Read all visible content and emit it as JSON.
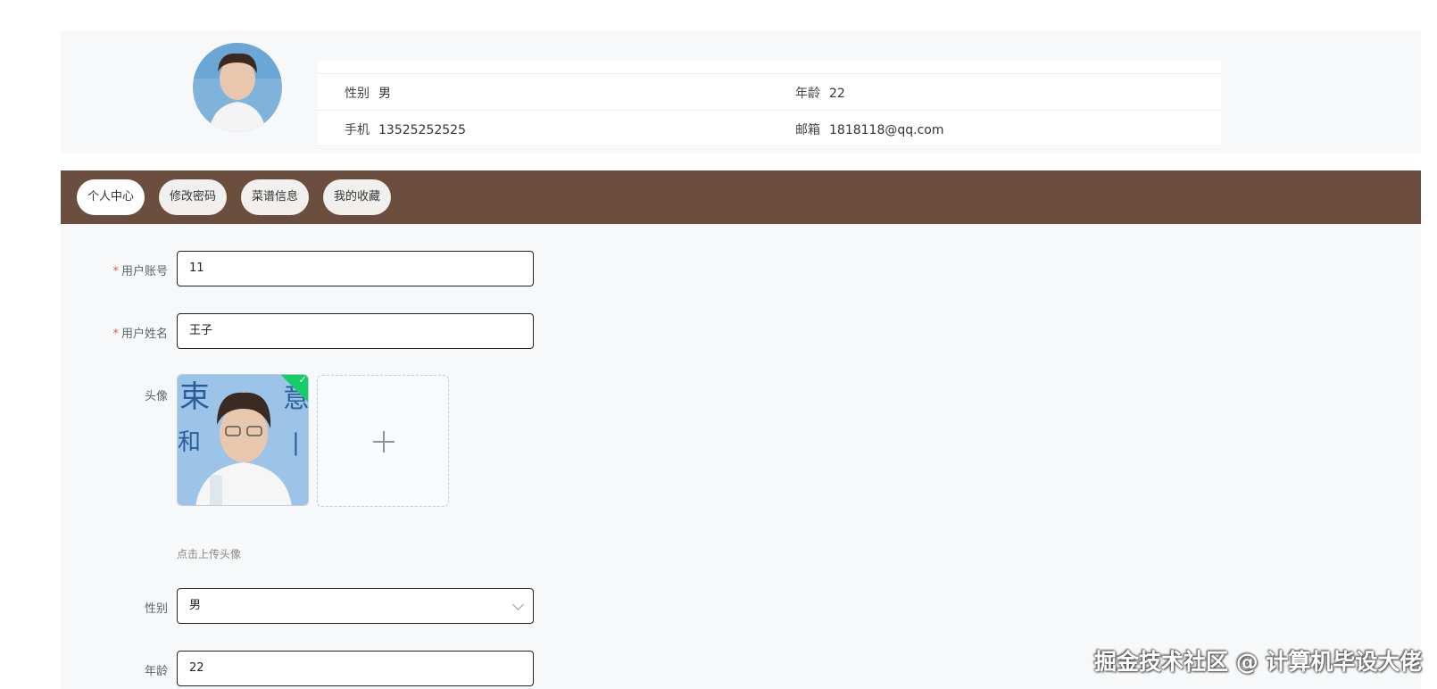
{
  "profile": {
    "gender_label": "性别",
    "gender_value": "男",
    "age_label": "年龄",
    "age_value": "22",
    "phone_label": "手机",
    "phone_value": "13525252525",
    "email_label": "邮箱",
    "email_value": "1818118@qq.com"
  },
  "tabs": [
    {
      "label": "个人中心",
      "active": true
    },
    {
      "label": "修改密码",
      "active": false
    },
    {
      "label": "菜谱信息",
      "active": false
    },
    {
      "label": "我的收藏",
      "active": false
    }
  ],
  "form": {
    "account_label": "用户账号",
    "account_value": "11",
    "name_label": "用户姓名",
    "name_value": "王子",
    "avatar_label": "头像",
    "upload_tip": "点击上传头像",
    "gender_label": "性别",
    "gender_value": "男",
    "age_label": "年龄",
    "age_value": "22",
    "required_mark": "*"
  },
  "watermark": "掘金技术社区 @ 计算机毕设大佬",
  "colors": {
    "tab_bar": "#6b4e3d",
    "required": "#e2625d",
    "success_badge": "#13ce66"
  }
}
